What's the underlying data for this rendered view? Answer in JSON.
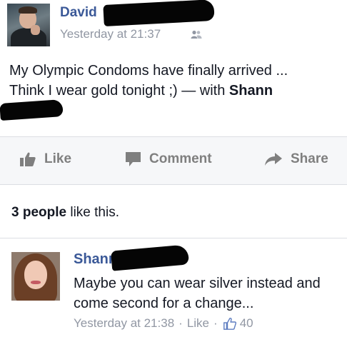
{
  "post": {
    "author": "David",
    "timestamp": "Yesterday at 21:37",
    "audience_icon": "friends-icon",
    "text_line1": "My Olympic Condoms have finally arrived ...",
    "text_line2": "Think I wear gold tonight ;) — with ",
    "tagged_name": "Shann"
  },
  "actions": {
    "like_label": "Like",
    "comment_label": "Comment",
    "share_label": "Share"
  },
  "likes": {
    "count_text": "3 people",
    "suffix": " like this."
  },
  "comment": {
    "author": "Shann",
    "text": "Maybe you can wear silver instead and come second for a change...",
    "timestamp": "Yesterday at 21:38",
    "separator": "·",
    "like_label": "Like",
    "like_count": "40"
  },
  "colors": {
    "name_link": "#3b5998",
    "meta_gray": "#9197a3",
    "action_gray": "#7f7f7f",
    "action_bar_bg": "#f6f7f9"
  }
}
